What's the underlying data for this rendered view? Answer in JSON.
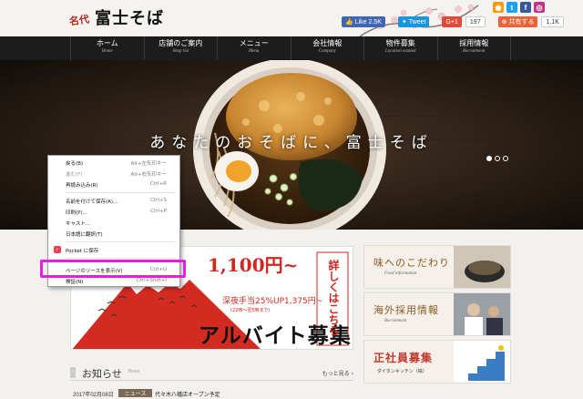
{
  "header": {
    "logo_prefix": "名代",
    "logo_main": "富士そば",
    "share": {
      "like_label": "Like 2.5K",
      "tweet_label": "Tweet",
      "gplus_label": "G+1",
      "gplus_count": "197",
      "hatena_label": "共有する",
      "hatena_count": "1.1K"
    },
    "social_icons": [
      {
        "icon": "rss-icon",
        "color": "#f39c12",
        "glyph": "◉"
      },
      {
        "icon": "twitter-icon",
        "color": "#1da1f2",
        "glyph": "t"
      },
      {
        "icon": "facebook-icon",
        "color": "#3b5998",
        "glyph": "f"
      },
      {
        "icon": "instagram-icon",
        "color": "#c13584",
        "glyph": "◎"
      }
    ]
  },
  "nav": [
    {
      "ja": "ホーム",
      "en": "Home"
    },
    {
      "ja": "店舗のご案内",
      "en": "Shop list"
    },
    {
      "ja": "メニュー",
      "en": "Menu"
    },
    {
      "ja": "会社情報",
      "en": "Company"
    },
    {
      "ja": "物件募集",
      "en": "Location wanted"
    },
    {
      "ja": "採用情報",
      "en": "Recruitment"
    }
  ],
  "hero": {
    "tagline": "あなたのおそばに、富士そば"
  },
  "banner": {
    "price1": "1,100円~",
    "sub": "深夜手当25%UP1,375円~",
    "sub_note": "(22時～翌5時まで)",
    "big_text": "アルバイト募集",
    "vertical": "詳しくはこちら"
  },
  "side_cards": [
    {
      "title": "味へのこだわり",
      "sub": "Food information"
    },
    {
      "title": "海外採用情報",
      "sub": "Recruitment"
    },
    {
      "title": "正社員募集",
      "sub": "ダイタンキッチン（株）"
    }
  ],
  "news": {
    "title": "お知らせ",
    "title_en": "News",
    "more": "もっと見る",
    "items": [
      {
        "date": "2017年02月08日",
        "category": "ニュース",
        "text": "代々木八幡店オープン予定"
      }
    ]
  },
  "context_menu": {
    "items": [
      {
        "label": "戻る(B)",
        "shortcut": "Alt+左矢印キー",
        "disabled": false
      },
      {
        "label": "進む(F)",
        "shortcut": "Alt+右矢印キー",
        "disabled": true
      },
      {
        "label": "再読み込み(R)",
        "shortcut": "Ctrl+R",
        "disabled": false
      },
      {
        "label": "名前を付けて保存(A)...",
        "shortcut": "Ctrl+S",
        "disabled": false
      },
      {
        "label": "印刷(P)...",
        "shortcut": "Ctrl+P",
        "disabled": false
      },
      {
        "label": "キャスト...",
        "shortcut": "",
        "disabled": false
      },
      {
        "label": "日本語に翻訳(T)",
        "shortcut": "",
        "disabled": false
      },
      {
        "label": "Pocket に保存",
        "shortcut": "",
        "disabled": false
      },
      {
        "label": "ページのソースを表示(V)",
        "shortcut": "Ctrl+U",
        "disabled": false
      },
      {
        "label": "検証(N)",
        "shortcut": "Ctrl+Shift+I",
        "disabled": false
      }
    ]
  },
  "colors": {
    "nav_bg": "#1c1c1c",
    "brand_red": "#d02720",
    "highlight": "#e61ee0",
    "pocket": "#e8404f"
  }
}
